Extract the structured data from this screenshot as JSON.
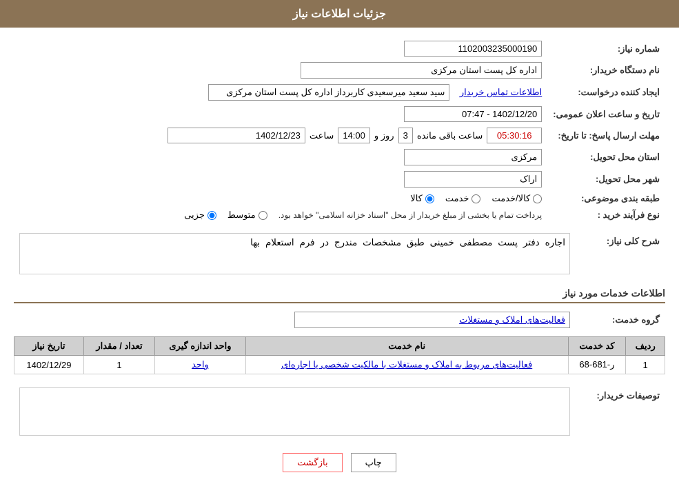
{
  "header": {
    "title": "جزئیات اطلاعات نیاز"
  },
  "form": {
    "need_number_label": "شماره نیاز:",
    "need_number_value": "1102003235000190",
    "buyer_org_label": "نام دستگاه خریدار:",
    "buyer_org_value": "اداره کل پست استان مرکزی",
    "creator_label": "ایجاد کننده درخواست:",
    "creator_value": "سید سعید میرسعیدی کاربرداز اداره کل پست استان مرکزی",
    "creator_link": "اطلاعات تماس خریدار",
    "announcement_label": "تاریخ و ساعت اعلان عمومی:",
    "announcement_date": "1402/12/20 - 07:47",
    "deadline_label": "مهلت ارسال پاسخ: تا تاریخ:",
    "deadline_date": "1402/12/23",
    "deadline_time_label": "ساعت",
    "deadline_time": "14:00",
    "deadline_days_label": "روز و",
    "deadline_days": "3",
    "deadline_remaining_label": "ساعت باقی مانده",
    "deadline_remaining": "05:30:16",
    "province_label": "استان محل تحویل:",
    "province_value": "مرکزی",
    "city_label": "شهر محل تحویل:",
    "city_value": "اراک",
    "category_label": "طبقه بندی موضوعی:",
    "category_options": [
      "کالا",
      "خدمت",
      "کالا/خدمت"
    ],
    "category_selected": "کالا",
    "purchase_type_label": "نوع فرآیند خرید :",
    "purchase_options": [
      "جزیی",
      "متوسط"
    ],
    "purchase_text": "پرداخت تمام یا بخشی از مبلغ خریدار از محل \"اسناد خزانه اسلامی\" خواهد بود.",
    "description_label": "شرح کلی نیاز:",
    "description_value": "اجاره دفتر پست مصطفی خمینی طبق مشخصات مندرج در فرم استعلام بها"
  },
  "services_section": {
    "title": "اطلاعات خدمات مورد نیاز",
    "group_label": "گروه خدمت:",
    "group_value": "فعالیت‌های  املاک و مستغلات",
    "table_headers": [
      "ردیف",
      "کد خدمت",
      "نام خدمت",
      "واحد اندازه گیری",
      "تعداد / مقدار",
      "تاریخ نیاز"
    ],
    "table_rows": [
      {
        "row": "1",
        "code": "ر-681-68",
        "name": "فعالیت‌های مربوط به املاک و مستغلات با مالکیت شخصی یا اجاره‌ای",
        "unit": "واحد",
        "quantity": "1",
        "date": "1402/12/29"
      }
    ]
  },
  "buyer_notes_label": "توصیفات خریدار:",
  "buttons": {
    "print": "چاپ",
    "back": "بازگشت"
  }
}
